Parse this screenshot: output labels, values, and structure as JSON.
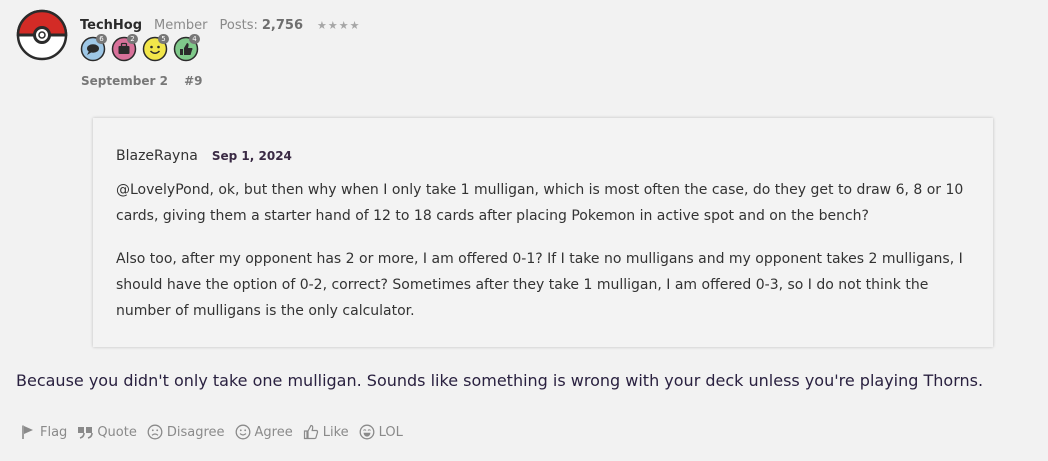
{
  "post": {
    "author": "TechHog",
    "role": "Member",
    "posts_label": "Posts:",
    "posts_count": "2,756",
    "rank_stars": "★★★★",
    "badges": [
      {
        "icon": "speech-bubble-badge-icon",
        "count": "6",
        "color": "#9ec7e6"
      },
      {
        "icon": "briefcase-badge-icon",
        "count": "2",
        "color": "#d8719a"
      },
      {
        "icon": "smiley-badge-icon",
        "count": "5",
        "color": "#f2e64a"
      },
      {
        "icon": "thumbs-up-badge-icon",
        "count": "4",
        "color": "#7fc98a"
      }
    ],
    "date": "September 2",
    "number": "#9"
  },
  "quote": {
    "author": "BlazeRayna",
    "date": "Sep 1, 2024",
    "paragraph1": "@LovelyPond, ok, but then why when I only take 1 mulligan, which is most often the case, do they get to draw 6, 8 or 10 cards, giving them a starter hand of 12 to 18 cards after placing Pokemon in active spot and on the bench?",
    "paragraph2": "Also too, after my opponent has 2 or more, I am offered 0-1? If I take no mulligans and my opponent takes 2 mulligans, I should have the option of 0-2, correct? Sometimes after they take 1 mulligan, I am offered 0-3, so I do not think the number of mulligans is the only calculator."
  },
  "reply_text": "Because you didn't only take one mulligan. Sounds like something is wrong with your deck unless you're playing Thorns.",
  "actions": {
    "flag": "Flag",
    "quote": "Quote",
    "disagree": "Disagree",
    "agree": "Agree",
    "like": "Like",
    "lol": "LOL"
  },
  "colors": {
    "background": "#f2f2f2",
    "pokeball_red": "#d32b26"
  }
}
